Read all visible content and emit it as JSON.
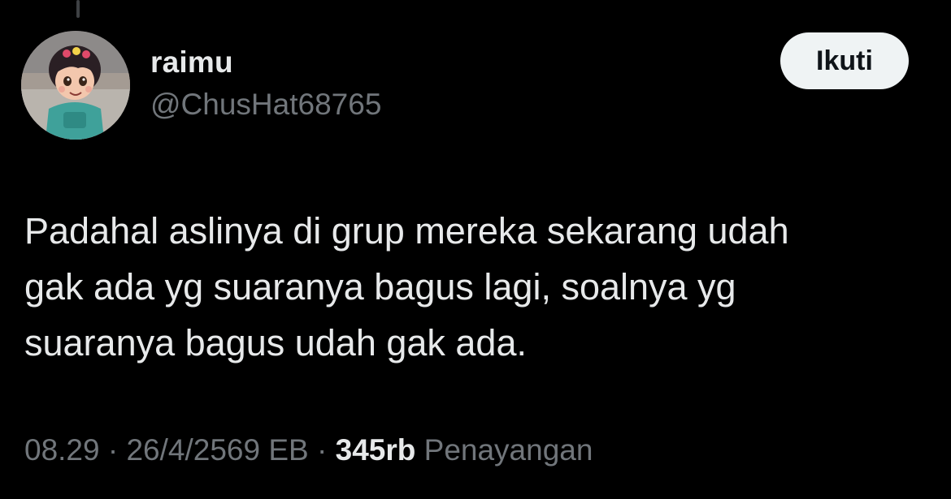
{
  "tweet": {
    "display_name": "raimu",
    "handle": "@ChusHat68765",
    "follow_label": "Ikuti",
    "text_lines": [
      "Padahal aslinya di grup mereka sekarang udah",
      "gak ada yg suaranya bagus lagi, soalnya yg",
      "suaranya bagus udah gak ada."
    ],
    "time": "08.29",
    "separator": " · ",
    "date": "26/4/2569 EB",
    "views_count": "345rb",
    "views_label": "Penayangan"
  },
  "icons": {
    "avatar": "cartoon-girl-avatar-image"
  },
  "colors": {
    "background": "#000000",
    "primary_text": "#e7e9ea",
    "secondary_text": "#71767b",
    "button_bg": "#eff3f4",
    "button_text": "#0f1419"
  }
}
